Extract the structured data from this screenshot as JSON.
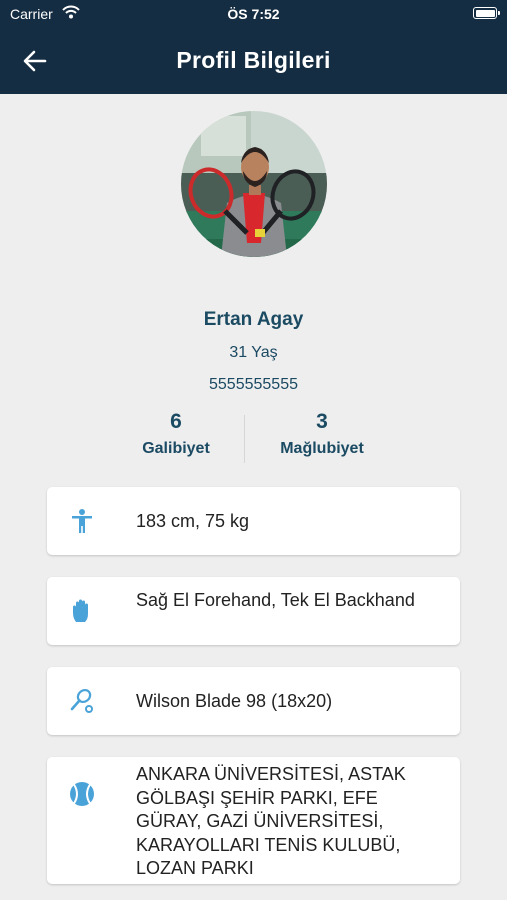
{
  "status_bar": {
    "carrier": "Carrier",
    "time": "ÖS 7:52"
  },
  "nav": {
    "title": "Profil Bilgileri",
    "back_icon": "arrow-left-icon"
  },
  "profile": {
    "name": "Ertan Agay",
    "age": "31 Yaş",
    "phone": "5555555555",
    "wins_count": "6",
    "wins_label": "Galibiyet",
    "losses_count": "3",
    "losses_label": "Mağlubiyet"
  },
  "details": [
    {
      "icon": "person-icon",
      "text": "183 cm, 75 kg"
    },
    {
      "icon": "hand-icon",
      "text": "Sağ El Forehand, Tek El Backhand"
    },
    {
      "icon": "racket-icon",
      "text": "Wilson Blade 98 (18x20)"
    },
    {
      "icon": "tennis-ball-icon",
      "text": "ANKARA ÜNİVERSİTESİ, ASTAK GÖLBAŞI ŞEHİR PARKI, EFE GÜRAY, GAZİ ÜNİVERSİTESİ, KARAYOLLARI TENİS KULUBÜ, LOZAN PARKI"
    }
  ],
  "colors": {
    "header": "#152d42",
    "accent_text": "#1b4a63",
    "icon": "#4aa3d8",
    "background": "#eeeeee"
  }
}
